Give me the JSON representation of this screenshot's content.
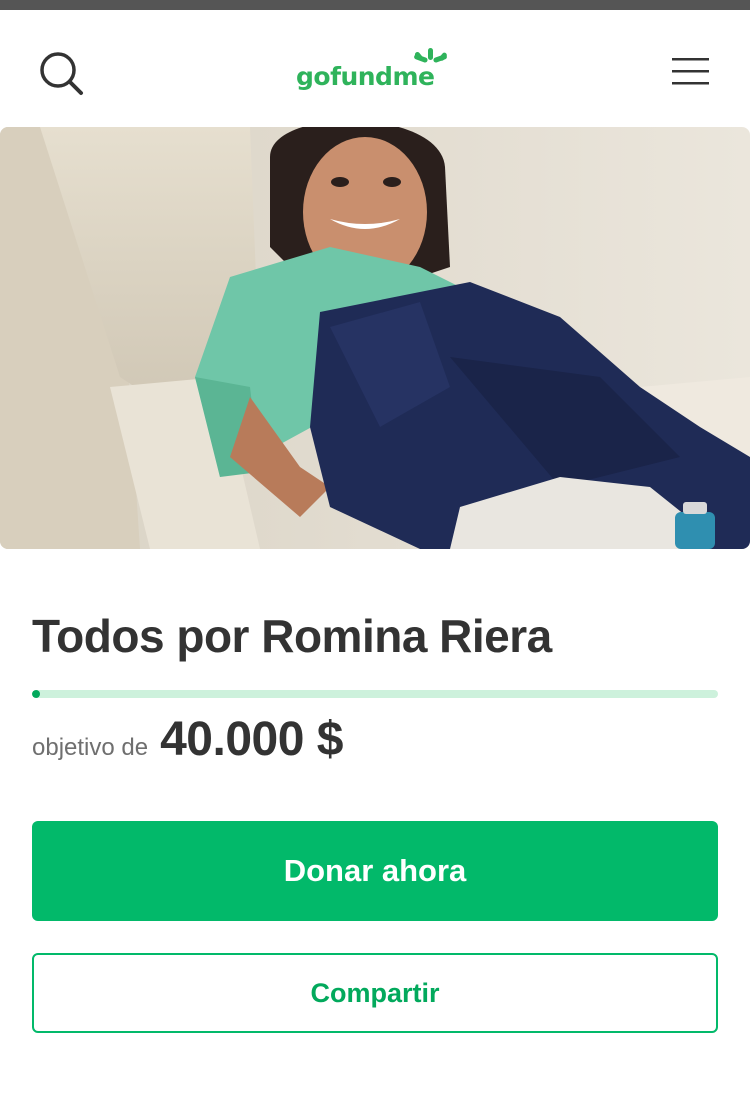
{
  "header": {
    "logo_text": "gofundme",
    "search_icon": "search-icon",
    "menu_icon": "hamburger-menu-icon"
  },
  "campaign": {
    "title": "Todos por Romina Riera",
    "progress_fraction": 0.005,
    "goal_label": "objetivo de",
    "goal_amount": "40.000 $"
  },
  "actions": {
    "donate_label": "Donar ahora",
    "share_label": "Compartir"
  },
  "colors": {
    "brand_green": "#02b96a",
    "progress_track": "#cdf1dc",
    "text_dark": "#333333",
    "text_muted": "#6f6f6f"
  }
}
